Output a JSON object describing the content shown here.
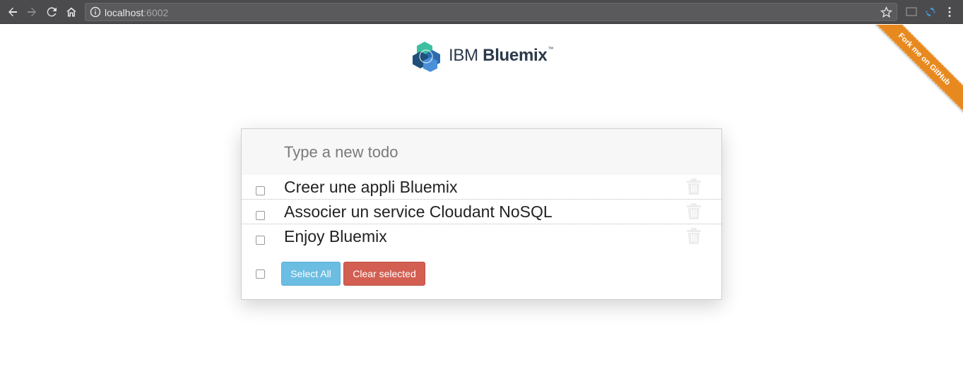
{
  "browser": {
    "url_host": "localhost",
    "url_port": ":6002",
    "icons": [
      "back-icon",
      "forward-icon",
      "reload-icon",
      "home-icon",
      "info-icon",
      "star-icon",
      "cast-icon",
      "extension-icon",
      "menu-icon"
    ]
  },
  "logo": {
    "ibm": "IBM",
    "bluemix": "Bluemix",
    "tm": "™"
  },
  "ribbon": {
    "label": "Fork me on GitHub",
    "color": "#e8891f"
  },
  "todo": {
    "placeholder": "Type a new todo",
    "items": [
      {
        "label": "Creer une appli Bluemix",
        "done": false
      },
      {
        "label": "Associer un service Cloudant NoSQL",
        "done": false
      },
      {
        "label": "Enjoy Bluemix",
        "done": false
      }
    ],
    "select_all_label": "Select All",
    "clear_selected_label": "Clear selected"
  },
  "colors": {
    "select_all": "#6cbde2",
    "clear_selected": "#d25f52"
  }
}
